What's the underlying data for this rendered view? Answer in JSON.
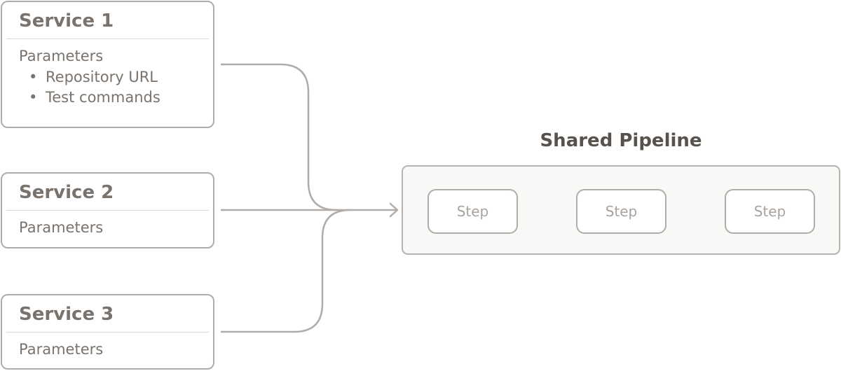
{
  "services": [
    {
      "title": "Service 1",
      "params_label": "Parameters",
      "params": [
        "Repository URL",
        "Test commands"
      ]
    },
    {
      "title": "Service 2",
      "params_label": "Parameters",
      "params": []
    },
    {
      "title": "Service 3",
      "params_label": "Parameters",
      "params": []
    }
  ],
  "pipeline": {
    "title": "Shared Pipeline",
    "steps": [
      "Step",
      "Step",
      "Step"
    ]
  },
  "colors": {
    "line": "#b1aca7",
    "text": "#7a736d",
    "title": "#58524d",
    "pipeline_bg": "#f8f8f7"
  }
}
